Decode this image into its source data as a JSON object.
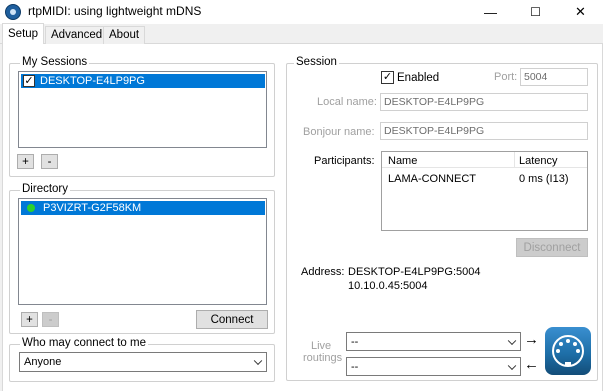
{
  "window": {
    "title": "rtpMIDI: using lightweight mDNS",
    "minimize": "—",
    "maximize": "☐",
    "close": "✕"
  },
  "tabs": [
    {
      "label": "Setup",
      "active": true
    },
    {
      "label": "Advanced",
      "active": false
    },
    {
      "label": "About",
      "active": false
    }
  ],
  "my_sessions": {
    "title": "My Sessions",
    "items": [
      {
        "label": "DESKTOP-E4LP9PG",
        "checked": true,
        "selected": true
      }
    ],
    "add_label": "+",
    "remove_label": "-"
  },
  "directory": {
    "title": "Directory",
    "items": [
      {
        "label": "P3VIZRT-G2F58KM",
        "status": "online",
        "selected": true
      }
    ],
    "add_label": "+",
    "remove_label": "-",
    "connect_label": "Connect"
  },
  "who_may_connect": {
    "title": "Who may connect to me",
    "value": "Anyone"
  },
  "session": {
    "title": "Session",
    "enabled_label": "Enabled",
    "enabled_checked": true,
    "port_label": "Port:",
    "port_value": "5004",
    "local_name_label": "Local name:",
    "local_name_value": "DESKTOP-E4LP9PG",
    "bonjour_name_label": "Bonjour name:",
    "bonjour_name_value": "DESKTOP-E4LP9PG",
    "participants_label": "Participants:",
    "participants_columns": [
      "Name",
      "Latency"
    ],
    "participants": [
      {
        "name": "LAMA-CONNECT",
        "latency": "0 ms (I13)"
      }
    ],
    "disconnect_label": "Disconnect",
    "address_label": "Address:",
    "address_lines": [
      "DESKTOP-E4LP9PG:5004",
      "10.10.0.45:5004"
    ],
    "live_routings_label_1": "Live",
    "live_routings_label_2": "routings",
    "routing_in_value": "--",
    "routing_out_value": "--",
    "arrow_right": "→",
    "arrow_left": "←"
  },
  "colors": {
    "selection": "#0078d7",
    "online": "#2cd12c",
    "midi_icon": "#1e6fa8"
  },
  "icons": {
    "checkmark": "✓"
  }
}
